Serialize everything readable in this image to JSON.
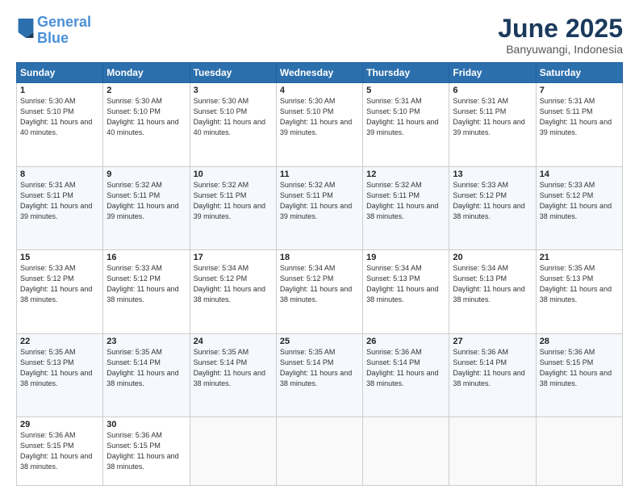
{
  "header": {
    "logo_line1": "General",
    "logo_line2": "Blue",
    "month_year": "June 2025",
    "location": "Banyuwangi, Indonesia"
  },
  "weekdays": [
    "Sunday",
    "Monday",
    "Tuesday",
    "Wednesday",
    "Thursday",
    "Friday",
    "Saturday"
  ],
  "weeks": [
    [
      {
        "day": "1",
        "sunrise": "5:30 AM",
        "sunset": "5:10 PM",
        "daylight": "11 hours and 40 minutes."
      },
      {
        "day": "2",
        "sunrise": "5:30 AM",
        "sunset": "5:10 PM",
        "daylight": "11 hours and 40 minutes."
      },
      {
        "day": "3",
        "sunrise": "5:30 AM",
        "sunset": "5:10 PM",
        "daylight": "11 hours and 40 minutes."
      },
      {
        "day": "4",
        "sunrise": "5:30 AM",
        "sunset": "5:10 PM",
        "daylight": "11 hours and 39 minutes."
      },
      {
        "day": "5",
        "sunrise": "5:31 AM",
        "sunset": "5:10 PM",
        "daylight": "11 hours and 39 minutes."
      },
      {
        "day": "6",
        "sunrise": "5:31 AM",
        "sunset": "5:11 PM",
        "daylight": "11 hours and 39 minutes."
      },
      {
        "day": "7",
        "sunrise": "5:31 AM",
        "sunset": "5:11 PM",
        "daylight": "11 hours and 39 minutes."
      }
    ],
    [
      {
        "day": "8",
        "sunrise": "5:31 AM",
        "sunset": "5:11 PM",
        "daylight": "11 hours and 39 minutes."
      },
      {
        "day": "9",
        "sunrise": "5:32 AM",
        "sunset": "5:11 PM",
        "daylight": "11 hours and 39 minutes."
      },
      {
        "day": "10",
        "sunrise": "5:32 AM",
        "sunset": "5:11 PM",
        "daylight": "11 hours and 39 minutes."
      },
      {
        "day": "11",
        "sunrise": "5:32 AM",
        "sunset": "5:11 PM",
        "daylight": "11 hours and 39 minutes."
      },
      {
        "day": "12",
        "sunrise": "5:32 AM",
        "sunset": "5:11 PM",
        "daylight": "11 hours and 38 minutes."
      },
      {
        "day": "13",
        "sunrise": "5:33 AM",
        "sunset": "5:12 PM",
        "daylight": "11 hours and 38 minutes."
      },
      {
        "day": "14",
        "sunrise": "5:33 AM",
        "sunset": "5:12 PM",
        "daylight": "11 hours and 38 minutes."
      }
    ],
    [
      {
        "day": "15",
        "sunrise": "5:33 AM",
        "sunset": "5:12 PM",
        "daylight": "11 hours and 38 minutes."
      },
      {
        "day": "16",
        "sunrise": "5:33 AM",
        "sunset": "5:12 PM",
        "daylight": "11 hours and 38 minutes."
      },
      {
        "day": "17",
        "sunrise": "5:34 AM",
        "sunset": "5:12 PM",
        "daylight": "11 hours and 38 minutes."
      },
      {
        "day": "18",
        "sunrise": "5:34 AM",
        "sunset": "5:12 PM",
        "daylight": "11 hours and 38 minutes."
      },
      {
        "day": "19",
        "sunrise": "5:34 AM",
        "sunset": "5:13 PM",
        "daylight": "11 hours and 38 minutes."
      },
      {
        "day": "20",
        "sunrise": "5:34 AM",
        "sunset": "5:13 PM",
        "daylight": "11 hours and 38 minutes."
      },
      {
        "day": "21",
        "sunrise": "5:35 AM",
        "sunset": "5:13 PM",
        "daylight": "11 hours and 38 minutes."
      }
    ],
    [
      {
        "day": "22",
        "sunrise": "5:35 AM",
        "sunset": "5:13 PM",
        "daylight": "11 hours and 38 minutes."
      },
      {
        "day": "23",
        "sunrise": "5:35 AM",
        "sunset": "5:14 PM",
        "daylight": "11 hours and 38 minutes."
      },
      {
        "day": "24",
        "sunrise": "5:35 AM",
        "sunset": "5:14 PM",
        "daylight": "11 hours and 38 minutes."
      },
      {
        "day": "25",
        "sunrise": "5:35 AM",
        "sunset": "5:14 PM",
        "daylight": "11 hours and 38 minutes."
      },
      {
        "day": "26",
        "sunrise": "5:36 AM",
        "sunset": "5:14 PM",
        "daylight": "11 hours and 38 minutes."
      },
      {
        "day": "27",
        "sunrise": "5:36 AM",
        "sunset": "5:14 PM",
        "daylight": "11 hours and 38 minutes."
      },
      {
        "day": "28",
        "sunrise": "5:36 AM",
        "sunset": "5:15 PM",
        "daylight": "11 hours and 38 minutes."
      }
    ],
    [
      {
        "day": "29",
        "sunrise": "5:36 AM",
        "sunset": "5:15 PM",
        "daylight": "11 hours and 38 minutes."
      },
      {
        "day": "30",
        "sunrise": "5:36 AM",
        "sunset": "5:15 PM",
        "daylight": "11 hours and 38 minutes."
      },
      null,
      null,
      null,
      null,
      null
    ]
  ]
}
